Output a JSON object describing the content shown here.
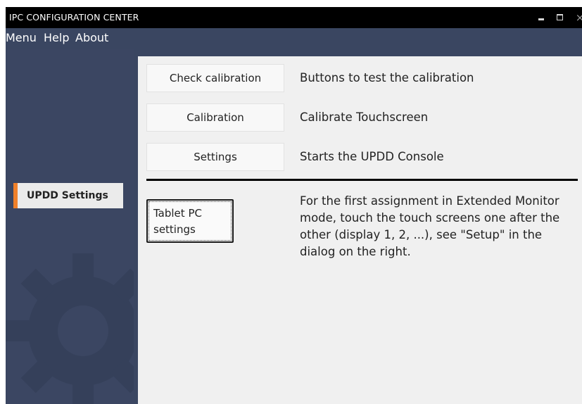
{
  "window": {
    "title": "IPC CONFIGURATION CENTER",
    "controls": {
      "minimize_icon": "minimize-icon",
      "maximize_icon": "maximize-icon",
      "close_glyph": "×"
    }
  },
  "menu": {
    "items": [
      {
        "label": "Menu"
      },
      {
        "label": "Help"
      },
      {
        "label": "About"
      }
    ]
  },
  "sidebar": {
    "items": [
      {
        "label": "UPDD Settings",
        "selected": true
      }
    ],
    "accent_color": "#f0802a",
    "background_icon": "gear-icon"
  },
  "main": {
    "actions": [
      {
        "button": "Check calibration",
        "description": "Buttons to test the calibration"
      },
      {
        "button": "Calibration",
        "description": "Calibrate Touchscreen"
      },
      {
        "button": "Settings",
        "description": "Starts the UPDD Console"
      }
    ],
    "tablet": {
      "button": "Tablet PC\nsettings",
      "info": "For the first assignment in Extended Monitor mode, touch the touch screens one after the other (display 1, 2, ...), see \"Setup\" in the dialog on the right."
    }
  },
  "colors": {
    "titlebar": "#000000",
    "chrome": "#3a4661",
    "content_bg": "#f0f0f0"
  }
}
